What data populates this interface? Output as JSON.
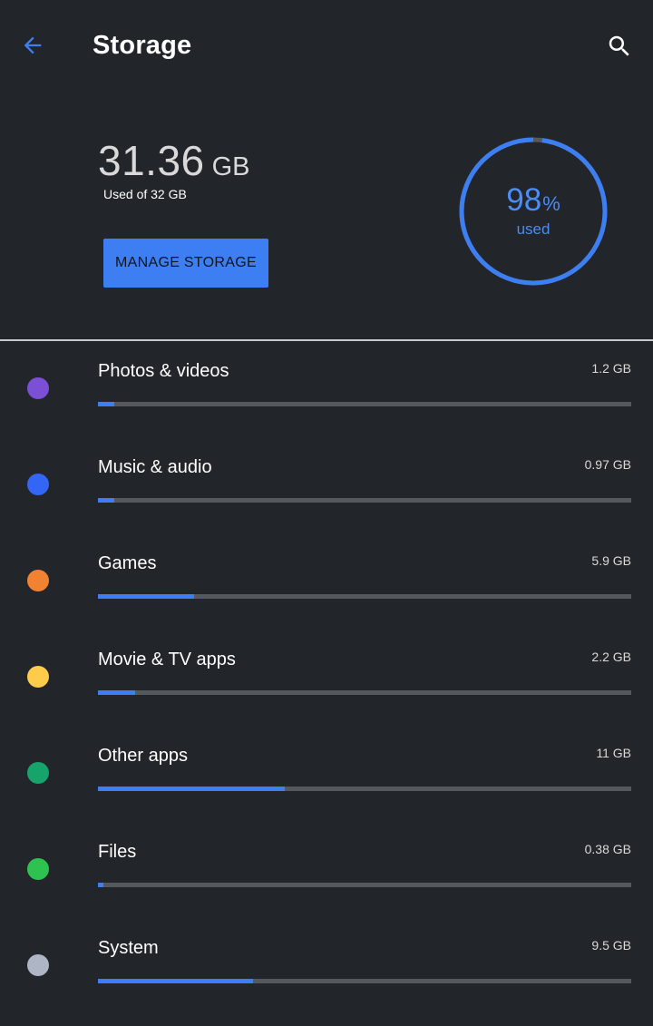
{
  "appbar": {
    "title": "Storage",
    "back_icon": "arrow-back-icon",
    "search_icon": "search-icon",
    "back_color": "#3d7ff2"
  },
  "summary": {
    "used_amount": "31.36",
    "used_unit": "GB",
    "used_of": "Used of 32 GB",
    "manage_button": "MANAGE STORAGE",
    "percent_value": "98",
    "percent_sign": "%",
    "percent_label": "used",
    "percent_fraction": 0.98
  },
  "colors": {
    "accent": "#3d7ff2",
    "background": "#22252a",
    "track": "#55585d"
  },
  "categories": [
    {
      "label": "Photos & videos",
      "size": "1.2 GB",
      "color": "#7b4fd6",
      "fraction": 0.03
    },
    {
      "label": "Music & audio",
      "size": "0.97 GB",
      "color": "#3366f5",
      "fraction": 0.03
    },
    {
      "label": "Games",
      "size": "5.9 GB",
      "color": "#f08232",
      "fraction": 0.18
    },
    {
      "label": "Movie & TV apps",
      "size": "2.2 GB",
      "color": "#fecb4a",
      "fraction": 0.07
    },
    {
      "label": "Other apps",
      "size": "11 GB",
      "color": "#16a36c",
      "fraction": 0.35
    },
    {
      "label": "Files",
      "size": "0.38 GB",
      "color": "#2ec351",
      "fraction": 0.01
    },
    {
      "label": "System",
      "size": "9.5 GB",
      "color": "#aeb6c6",
      "fraction": 0.29
    }
  ]
}
